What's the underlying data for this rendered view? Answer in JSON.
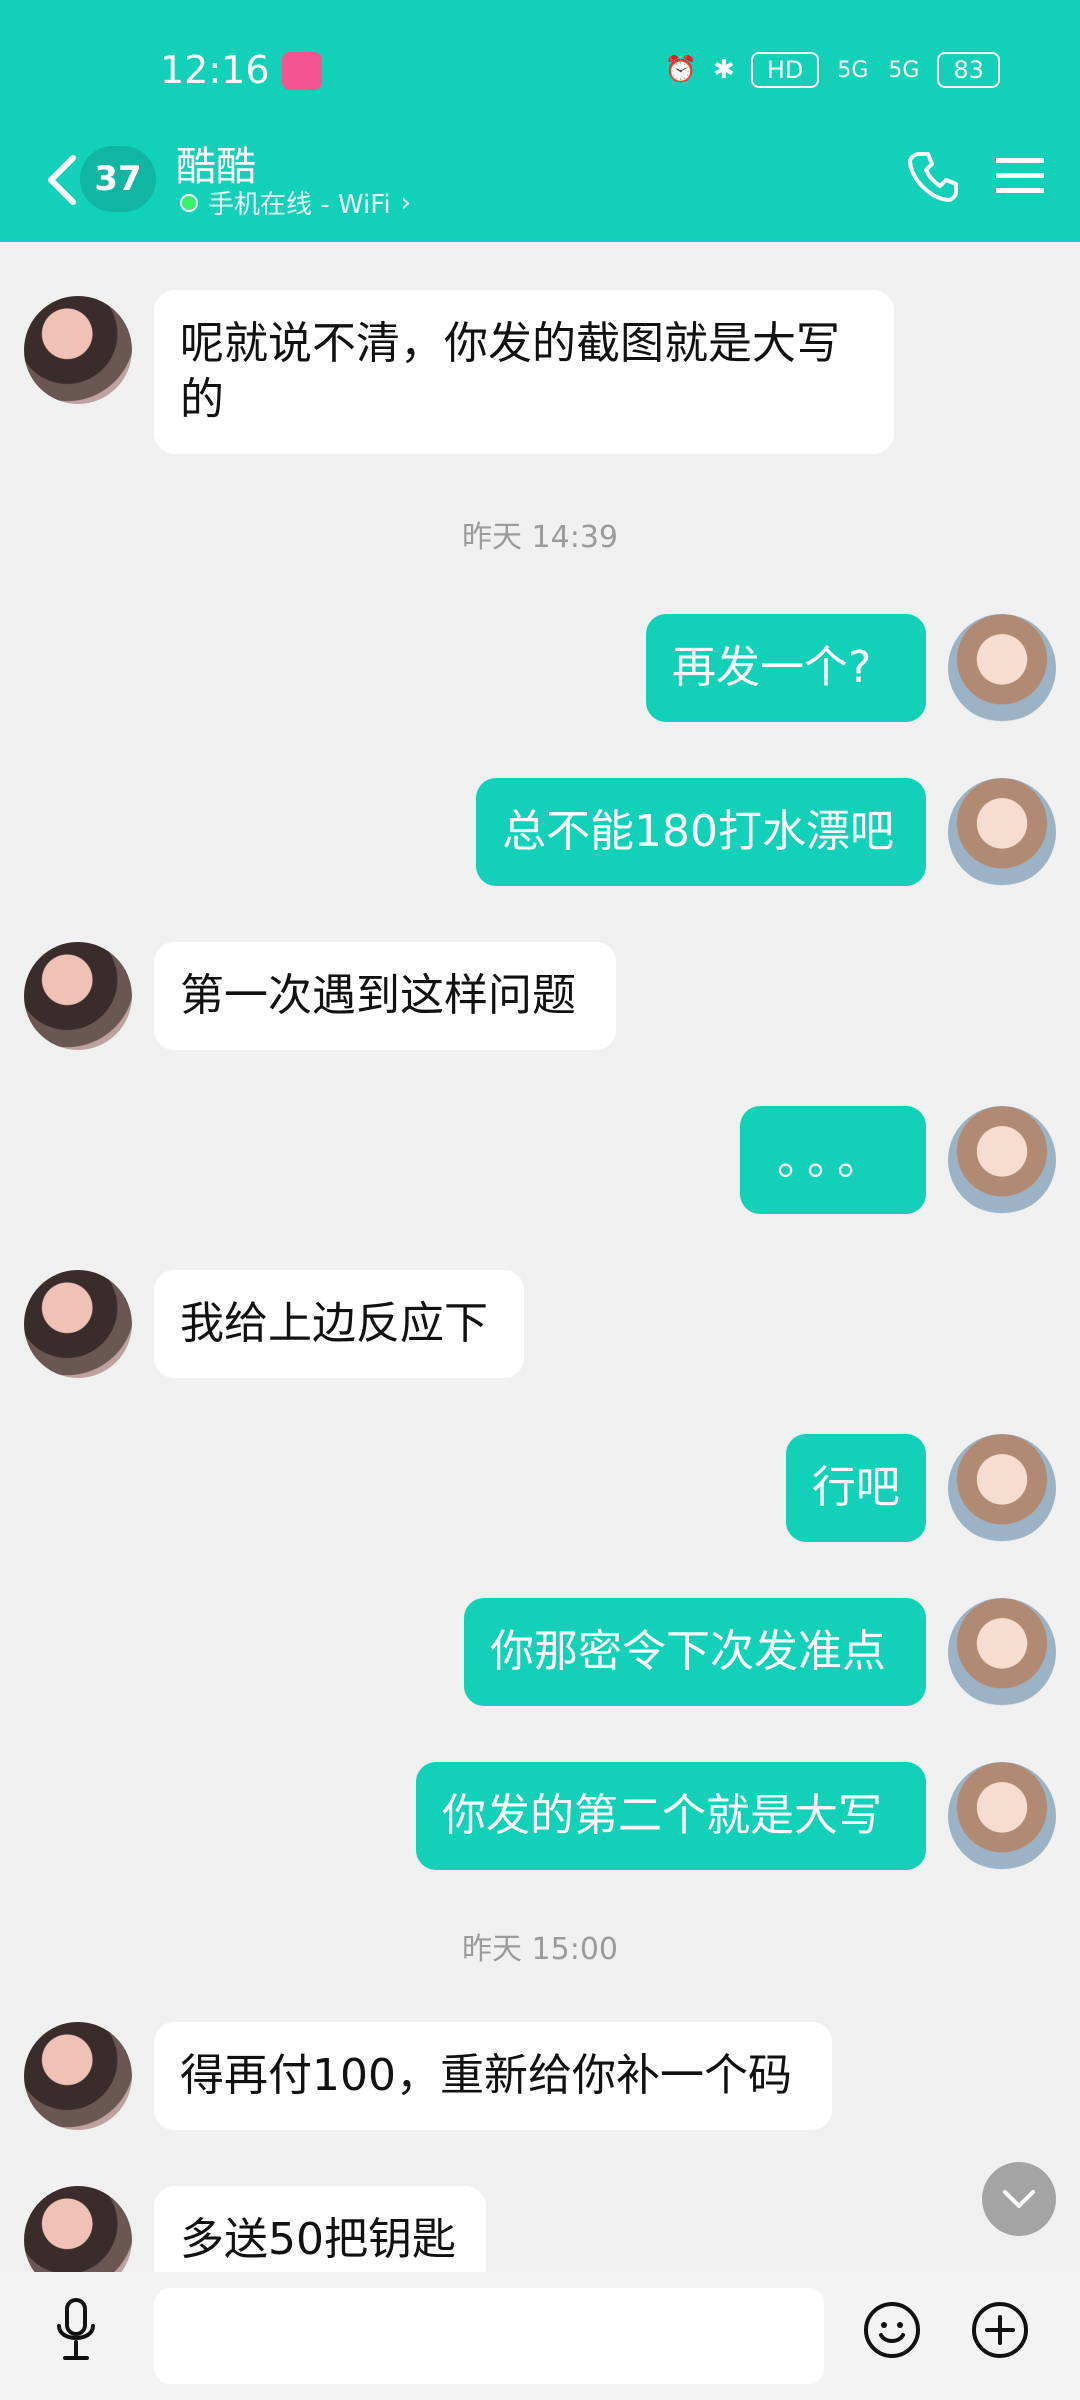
{
  "status_bar": {
    "time": "12:16",
    "network_badges": [
      "HD",
      "5G",
      "5G"
    ],
    "battery": "83"
  },
  "header": {
    "back_badge": "37",
    "title": "酷酷",
    "subtitle": "手机在线 - WiFi",
    "accent": "#12d1b8"
  },
  "messages": [
    {
      "side": "left",
      "text": "呢就说不清，你发的截图就是大写\n的"
    },
    {
      "type": "time",
      "text": "昨天 14:39"
    },
    {
      "side": "right",
      "text": "再发一个?"
    },
    {
      "side": "right",
      "text": "总不能180打水漂吧"
    },
    {
      "side": "left",
      "text": "第一次遇到这样问题"
    },
    {
      "side": "right",
      "text": "。。。"
    },
    {
      "side": "left",
      "text": "我给上边反应下"
    },
    {
      "side": "right",
      "text": "行吧"
    },
    {
      "side": "right",
      "text": "你那密令下次发准点"
    },
    {
      "side": "right",
      "text": "你发的第二个就是大写"
    },
    {
      "type": "time",
      "text": "昨天 15:00"
    },
    {
      "side": "left",
      "text": "得再付100，重新给你补一个码"
    },
    {
      "side": "left",
      "text": "多送50把钥匙"
    }
  ],
  "input_bar": {
    "placeholder": ""
  }
}
